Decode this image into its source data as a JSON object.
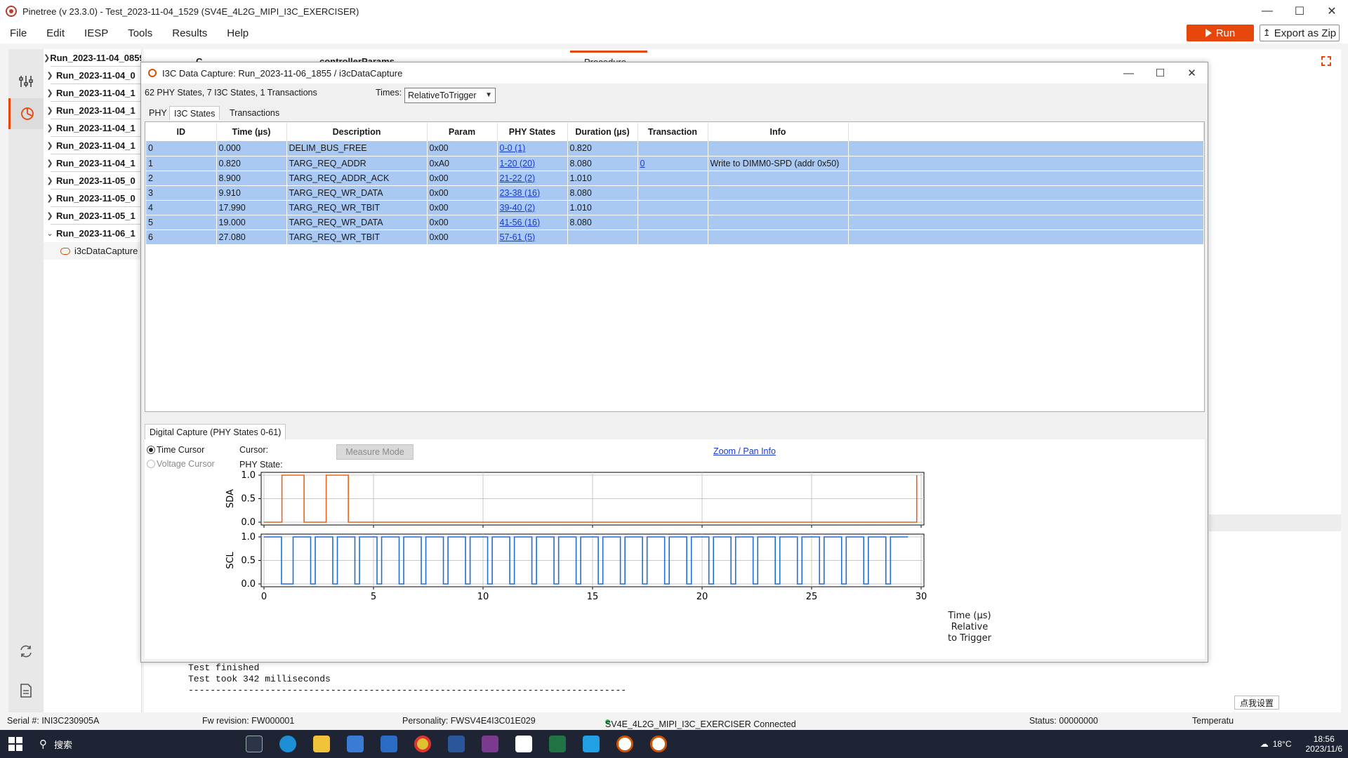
{
  "window": {
    "title": "Pinetree (v 23.3.0) - Test_2023-11-04_1529 (SV4E_4L2G_MIPI_I3C_EXERCISER)"
  },
  "menu": [
    "File",
    "Edit",
    "IESP",
    "Tools",
    "Results",
    "Help"
  ],
  "toolbar": {
    "run_label": "Run",
    "export_label": "Export as Zip"
  },
  "run_tree": {
    "items": [
      "Run_2023-11-04_0859",
      "Run_2023-11-04_0",
      "Run_2023-11-04_1",
      "Run_2023-11-04_1",
      "Run_2023-11-04_1",
      "Run_2023-11-04_1",
      "Run_2023-11-04_1",
      "Run_2023-11-05_0",
      "Run_2023-11-05_0",
      "Run_2023-11-05_1",
      "Run_2023-11-06_1"
    ],
    "child": "i3cDataCapture"
  },
  "background": {
    "tab1": "C",
    "tab2": "controllerParams",
    "procedure": "Procedure"
  },
  "dialog": {
    "title": "I3C Data Capture: Run_2023-11-06_1855 / i3cDataCapture",
    "summary": "62 PHY States, 7 I3C States, 1 Transactions",
    "times_label": "Times:",
    "times_value": "RelativeToTrigger",
    "tabs": [
      "PHY",
      "I3C States",
      "Transactions"
    ],
    "active_tab": "I3C States",
    "columns": [
      "ID",
      "Time (µs)",
      "Description",
      "Param",
      "PHY States",
      "Duration (µs)",
      "Transaction",
      "Info"
    ],
    "rows": [
      [
        "0",
        "0.000",
        "DELIM_BUS_FREE",
        "0x00",
        "0-0 (1)",
        "0.820",
        "",
        ""
      ],
      [
        "1",
        "0.820",
        "TARG_REQ_ADDR",
        "0xA0",
        "1-20 (20)",
        "8.080",
        "0",
        "Write to DIMM0-SPD (addr 0x50)"
      ],
      [
        "2",
        "8.900",
        "TARG_REQ_ADDR_ACK",
        "0x00",
        "21-22 (2)",
        "1.010",
        "",
        ""
      ],
      [
        "3",
        "9.910",
        "TARG_REQ_WR_DATA",
        "0x00",
        "23-38 (16)",
        "8.080",
        "",
        ""
      ],
      [
        "4",
        "17.990",
        "TARG_REQ_WR_TBIT",
        "0x00",
        "39-40 (2)",
        "1.010",
        "",
        ""
      ],
      [
        "5",
        "19.000",
        "TARG_REQ_WR_DATA",
        "0x00",
        "41-56 (16)",
        "8.080",
        "",
        ""
      ],
      [
        "6",
        "27.080",
        "TARG_REQ_WR_TBIT",
        "0x00",
        "57-61 (5)",
        "",
        "",
        ""
      ]
    ],
    "capture_tab": "Digital Capture (PHY States 0-61)",
    "time_cursor": "Time Cursor",
    "voltage_cursor": "Voltage Cursor",
    "cursor_label": "Cursor:",
    "phy_state_label": "PHY State:",
    "measure_mode": "Measure Mode",
    "zoom_pan": "Zoom / Pan Info",
    "xlabel_line1": "Time (µs)",
    "xlabel_line2": "Relative",
    "xlabel_line3": "to Trigger"
  },
  "chart_data": [
    {
      "type": "line",
      "ylabel": "SDA",
      "color": "#e8641c",
      "xlim": [
        0,
        30
      ],
      "ylim": [
        0,
        1
      ],
      "yticks": [
        "0.0",
        "0.5",
        "1.0"
      ],
      "grid": true,
      "step": true,
      "x": [
        0,
        0.82,
        0.82,
        1.83,
        1.83,
        2.84,
        2.84,
        3.85,
        3.85,
        29.8,
        29.8
      ],
      "y": [
        0,
        0,
        1,
        1,
        0,
        0,
        1,
        1,
        0,
        0,
        1
      ]
    },
    {
      "type": "line",
      "ylabel": "SCL",
      "color": "#1f6fd1",
      "xlim": [
        0,
        30
      ],
      "ylim": [
        0,
        1
      ],
      "xticks": [
        "0",
        "5",
        "10",
        "15",
        "20",
        "25",
        "30"
      ],
      "yticks": [
        "0.0",
        "0.5",
        "1.0"
      ],
      "grid": true,
      "step": true,
      "x_high_start": [
        0,
        1.33,
        2.34,
        3.35,
        4.36,
        5.37,
        6.38,
        7.39,
        8.4,
        9.41,
        10.42,
        11.43,
        12.44,
        13.45,
        14.46,
        15.47,
        16.48,
        17.49,
        18.5,
        19.51,
        20.52,
        21.53,
        22.54,
        23.55,
        24.56,
        25.57,
        26.58,
        27.59,
        28.6
      ],
      "high_width": 0.8
    }
  ],
  "console": [
    "Test finished",
    "Test took 342 milliseconds",
    "--------------------------------------------------------------------------------"
  ],
  "console_button": "点我设置",
  "status": {
    "serial": "Serial #:   INI3C230905A",
    "fw": "Fw revision: FW000001",
    "personality": "Personality: FWSV4E4I3C01E029",
    "connection": "SV4E_4L2G_MIPI_I3C_EXERCISER  Connected",
    "status": "Status: 00000000",
    "temperature": "Temperatu"
  },
  "taskbar": {
    "search": "搜索",
    "weather": "18°C",
    "time": "18:56",
    "date": "2023/11/6"
  }
}
